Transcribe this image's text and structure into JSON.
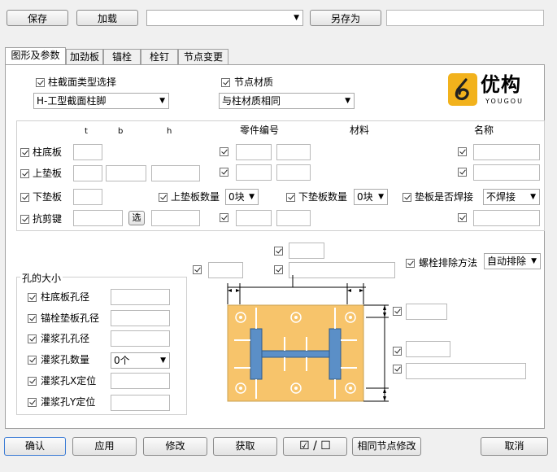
{
  "toolbar": {
    "save": "保存",
    "load": "加载",
    "template_value": "",
    "save_as": "另存为",
    "name_value": ""
  },
  "tabs": [
    "图形及参数",
    "加劲板",
    "锚栓",
    "栓钉",
    "节点变更"
  ],
  "top": {
    "section_type_label": "柱截面类型选择",
    "section_type_value": "H-工型截面柱脚",
    "node_material_label": "节点材质",
    "node_material_value": "与柱材质相同"
  },
  "logo": {
    "text": "优构",
    "sub": "YOUGOU",
    "bg": "#f2b21c"
  },
  "table": {
    "col_t": "t",
    "col_b": "b",
    "col_h": "h",
    "col_part_no": "零件编号",
    "col_material": "材料",
    "col_name": "名称",
    "rows": [
      "柱底板",
      "上垫板",
      "下垫板",
      "抗剪键"
    ],
    "upper_pad_count_label": "上垫板数量",
    "upper_pad_count_value": "0块",
    "lower_pad_count_label": "下垫板数量",
    "lower_pad_count_value": "0块",
    "pad_weld_label": "垫板是否焊接",
    "pad_weld_value": "不焊接",
    "select_btn": "选"
  },
  "holes": {
    "title": "孔的大小",
    "items": [
      "柱底板孔径",
      "锚栓垫板孔径",
      "灌浆孔孔径",
      "灌浆孔数量",
      "灌浆孔X定位",
      "灌浆孔Y定位"
    ],
    "count_value": "0个"
  },
  "bolt": {
    "exclude_label": "螺栓排除方法",
    "exclude_value": "自动排除"
  },
  "bottom": {
    "confirm": "确认",
    "apply": "应用",
    "modify": "修改",
    "fetch": "获取",
    "toggle": "☑ / ☐",
    "same_node": "相同节点修改",
    "cancel": "取消"
  },
  "colors": {
    "plate": "#f7c46b",
    "steel": "#5b8fc7",
    "accent": "#3a7bd5"
  },
  "icons": {
    "dropdown": "chevron-down-icon",
    "check": "checkmark-icon"
  }
}
